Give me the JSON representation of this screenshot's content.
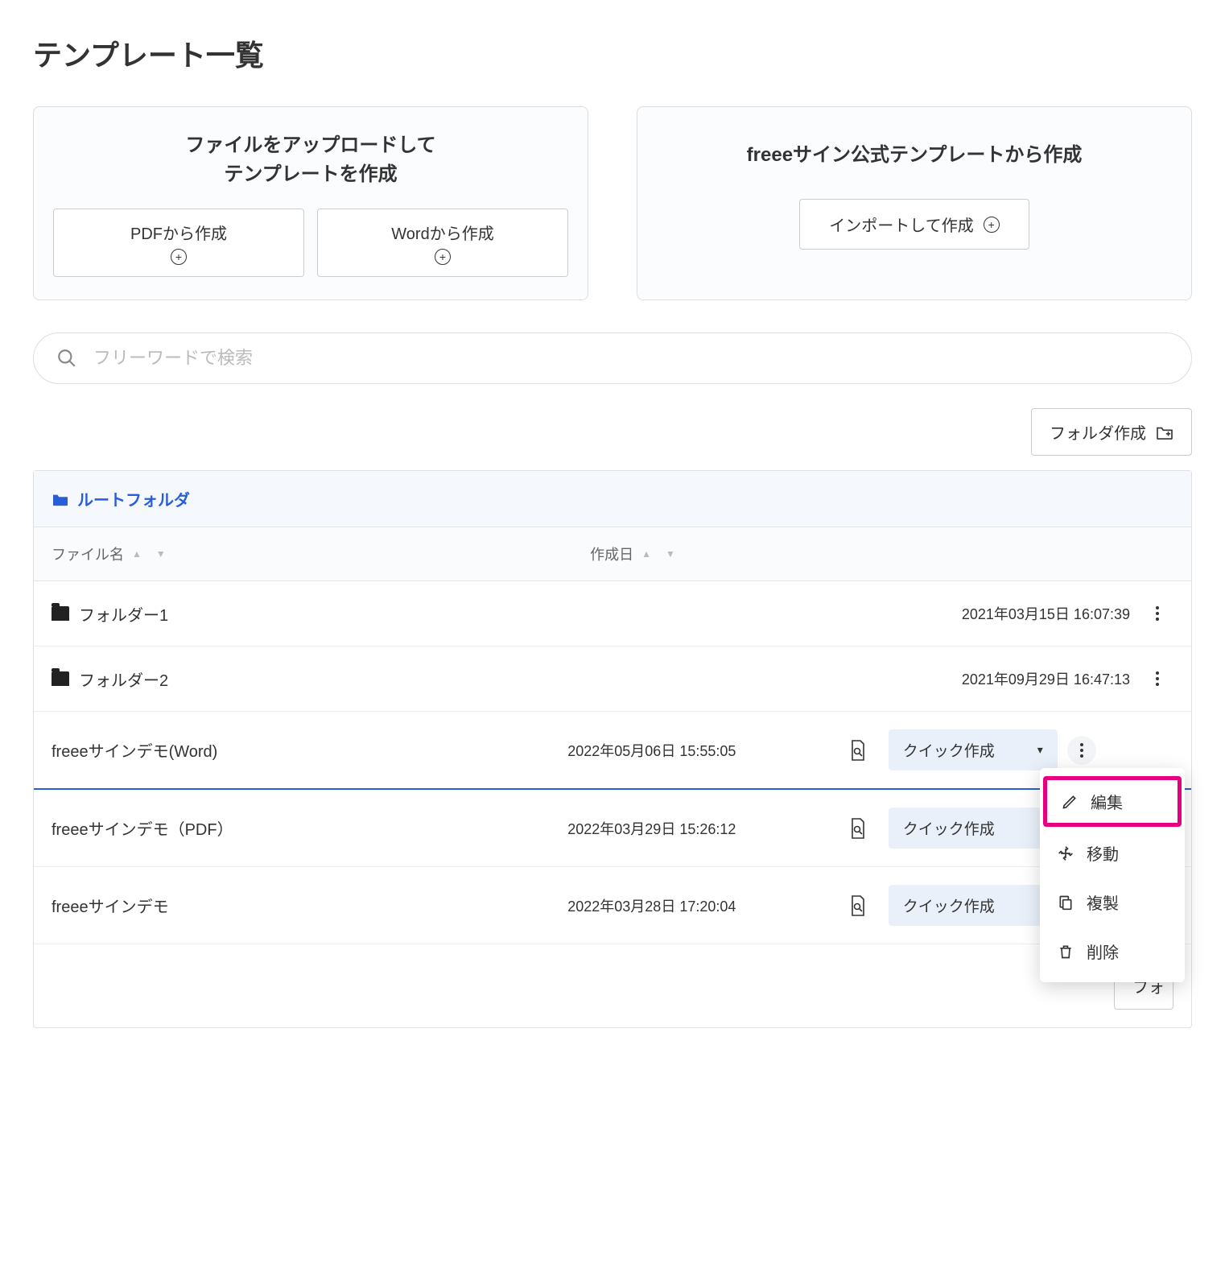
{
  "page_title": "テンプレート一覧",
  "cards": {
    "upload": {
      "title_line1": "ファイルをアップロードして",
      "title_line2": "テンプレートを作成",
      "btn_pdf": "PDFから作成",
      "btn_word": "Wordから作成"
    },
    "official": {
      "title": "freeeサイン公式テンプレートから作成",
      "btn_import": "インポートして作成"
    }
  },
  "search": {
    "placeholder": "フリーワードで検索"
  },
  "create_folder_label": "フォルダ作成",
  "breadcrumb": {
    "root": "ルートフォルダ"
  },
  "columns": {
    "filename": "ファイル名",
    "created": "作成日"
  },
  "quick_create_label": "クイック作成",
  "footer_btn_stub": "フォ",
  "rows": [
    {
      "type": "folder",
      "name": "フォルダー1",
      "date": "2021年03月15日 16:07:39"
    },
    {
      "type": "folder",
      "name": "フォルダー2",
      "date": "2021年09月29日 16:47:13"
    },
    {
      "type": "file",
      "name": "freeeサインデモ(Word)",
      "date": "2022年05月06日 15:55:05",
      "menu_open": true
    },
    {
      "type": "file",
      "name": "freeeサインデモ（PDF）",
      "date": "2022年03月29日 15:26:12"
    },
    {
      "type": "file",
      "name": "freeeサインデモ",
      "date": "2022年03月28日 17:20:04"
    }
  ],
  "context_menu": {
    "edit": "編集",
    "move": "移動",
    "duplicate": "複製",
    "delete": "削除"
  }
}
